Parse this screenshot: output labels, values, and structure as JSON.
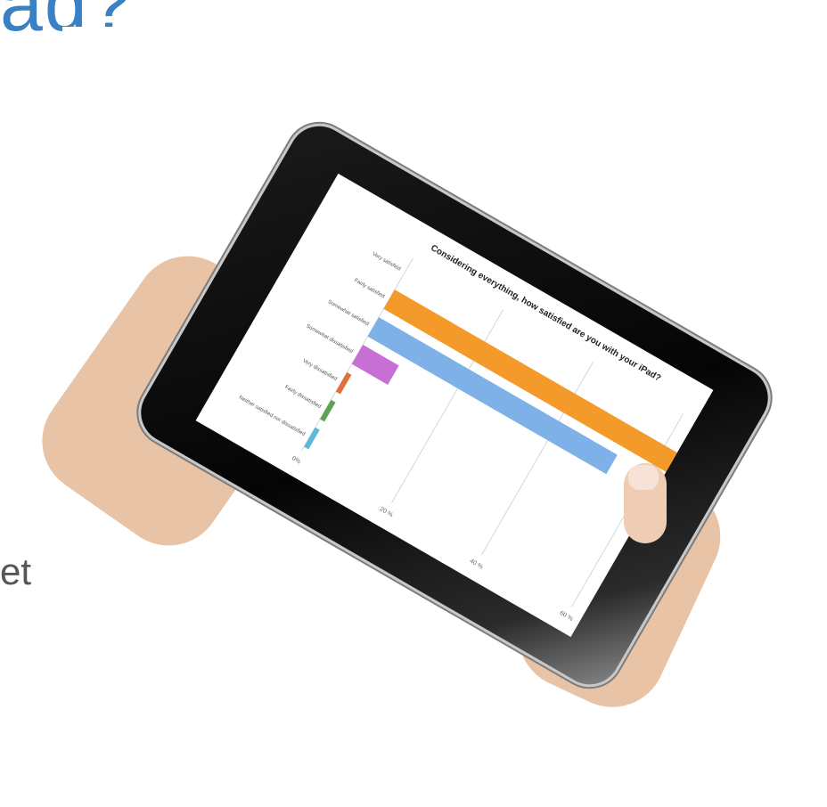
{
  "slide": {
    "title_fragment": "ad?",
    "body_fragment": "et"
  },
  "chart_data": {
    "type": "bar",
    "title": "Considering everything, how satisfied are you with your iPad?",
    "categories": [
      "Very satisfied",
      "Fairly satisfied",
      "Somewhat satisfied",
      "Somewhat dissatisfied",
      "Very dissatisfied",
      "Fairly dissatisfied",
      "Neither satisfied nor dissatisfied"
    ],
    "series": [
      {
        "values": [
          0,
          71,
          53,
          8,
          1,
          1,
          1
        ]
      }
    ],
    "colors": [
      "#f39a2b",
      "#f39a2b",
      "#7eb1e8",
      "#c86fd6",
      "#e2703a",
      "#5aa455",
      "#5ab8d8"
    ],
    "xticks": [
      "0%",
      "20 %",
      "40 %",
      "60 %"
    ],
    "xlim": [
      0,
      60
    ],
    "grid": true
  }
}
